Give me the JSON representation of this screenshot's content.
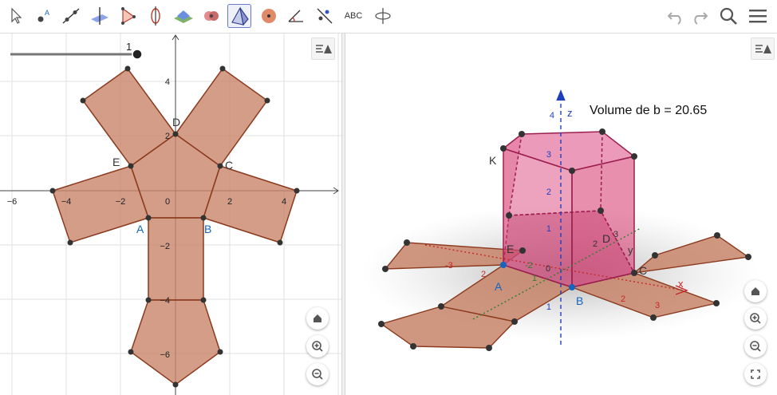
{
  "toolbar": {
    "tools": [
      {
        "name": "move-tool",
        "icon": "arrow-pointer-icon"
      },
      {
        "name": "point-tool",
        "icon": "point-icon"
      },
      {
        "name": "line-tool",
        "icon": "line-icon"
      },
      {
        "name": "perpendicular-tool",
        "icon": "perpendicular-plane-icon"
      },
      {
        "name": "polygon-tool",
        "icon": "polygon-icon"
      },
      {
        "name": "rotation-tool",
        "icon": "rotation-axis-icon"
      },
      {
        "name": "plane-tool",
        "icon": "plane-icon"
      },
      {
        "name": "intersect-tool",
        "icon": "intersect-surfaces-icon"
      },
      {
        "name": "pyramid-tool",
        "icon": "pyramid-icon"
      },
      {
        "name": "sphere-tool",
        "icon": "sphere-icon"
      },
      {
        "name": "angle-tool",
        "icon": "angle-icon"
      },
      {
        "name": "reflect-tool",
        "icon": "reflect-icon"
      },
      {
        "name": "text-tool",
        "label": "ABC"
      },
      {
        "name": "rotate-view-tool",
        "icon": "rotate-view-icon"
      }
    ],
    "undo_icon": "undo-icon",
    "redo_icon": "redo-icon",
    "search_icon": "search-icon",
    "menu_icon": "hamburger-menu-icon"
  },
  "view2d": {
    "slider_value": "1",
    "x_ticks": [
      "−6",
      "−4",
      "−2",
      "0",
      "2",
      "4"
    ],
    "y_ticks": [
      "4",
      "2",
      "−2",
      "−4",
      "−6"
    ],
    "points": [
      {
        "label": "A",
        "color": "#1565c0"
      },
      {
        "label": "B",
        "color": "#1565c0"
      },
      {
        "label": "C",
        "color": "#333333"
      },
      {
        "label": "D",
        "color": "#333333"
      },
      {
        "label": "E",
        "color": "#333333"
      }
    ],
    "nav": {
      "home_icon": "home-icon",
      "zoom_in_icon": "zoom-in-icon",
      "zoom_out_icon": "zoom-out-icon"
    }
  },
  "view3d": {
    "volume_text": "Volume de b = 20.65",
    "axis_z_label": "z",
    "axis_x_label": "x",
    "axis_y_label": "y",
    "z_ticks": [
      "4",
      "3",
      "2",
      "1",
      "1"
    ],
    "x_ticks": [
      "2",
      "3"
    ],
    "y_ticks": [
      "3",
      "2"
    ],
    "neg_ticks": [
      "-3",
      "-2",
      "2",
      "1",
      "0"
    ],
    "points": [
      {
        "label": "K",
        "color": "#333333"
      },
      {
        "label": "E",
        "color": "#333333"
      },
      {
        "label": "D",
        "color": "#333333"
      },
      {
        "label": "C",
        "color": "#333333"
      },
      {
        "label": "A",
        "color": "#1565c0"
      },
      {
        "label": "B",
        "color": "#1565c0"
      }
    ],
    "nav": {
      "home_icon": "home-icon",
      "zoom_in_icon": "zoom-in-icon",
      "zoom_out_icon": "zoom-out-icon",
      "fullscreen_icon": "fullscreen-icon"
    }
  },
  "colors": {
    "net_fill": "#c8856a",
    "net_edge": "#8b3a1e",
    "prism": "#d6336c",
    "axis_blue": "#1f3fbf",
    "axis_red": "#c62828",
    "axis_green": "#2e7d32",
    "label_blue": "#1565c0"
  }
}
